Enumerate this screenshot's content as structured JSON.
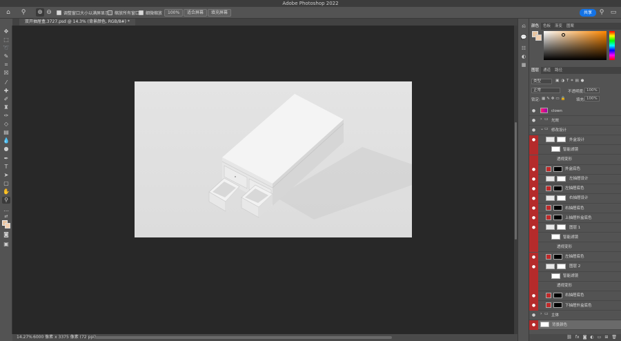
{
  "app": {
    "title": "Adobe Photoshop 2022"
  },
  "options_bar": {
    "resize_windows_label": "调整窗口大小以满屏显示",
    "zoom_all_label": "缩放所有窗口",
    "scrubby_zoom_label": "细微缩放",
    "zoom_100_label": "100%",
    "fit_screen_label": "适合屏幕",
    "fill_screen_label": "填充屏幕",
    "share_label": "共享"
  },
  "document_tab": {
    "label": "双开抽屉盒.3727.psd @ 14.3% (背景颜色, RGB/8#) *"
  },
  "status_bar": {
    "zoom": "14.27%",
    "doc_size": "6000 像素 x 3375 像素 (72 ppi)"
  },
  "color_panel": {
    "tabs": [
      "颜色",
      "色板",
      "渐变",
      "图案"
    ],
    "active_tab": "颜色",
    "foreground": "#e8c4a0",
    "background": "#f2d0b0"
  },
  "layers_panel": {
    "tabs": [
      "图层",
      "通道",
      "路径"
    ],
    "active_tab": "图层",
    "filter_kind": "类型",
    "blend_mode": "正常",
    "opacity_label": "不透明度:",
    "opacity_value": "100%",
    "lock_label": "锁定:",
    "fill_label": "填充:",
    "fill_value": "100%",
    "layers": [
      {
        "name": "clown",
        "indent": 0,
        "thumb": "magenta",
        "visible_red": false
      },
      {
        "name": "光效",
        "indent": 0,
        "thumb": "folder",
        "visible_red": false
      },
      {
        "name": "修改设计",
        "indent": 0,
        "thumb": "folder-open",
        "visible_red": false
      },
      {
        "name": "外盒设计",
        "indent": 1,
        "thumb": "smart",
        "visible_red": true
      },
      {
        "name": "智能滤镜",
        "indent": 2,
        "thumb": "white",
        "visible_red": true
      },
      {
        "name": "透视变形",
        "indent": 3,
        "thumb": "none",
        "visible_red": true
      },
      {
        "name": "外盒底色",
        "indent": 1,
        "thumb": "red-black",
        "visible_red": true
      },
      {
        "name": "左抽屉设计",
        "indent": 1,
        "thumb": "smart",
        "visible_red": true
      },
      {
        "name": "左抽屉底色",
        "indent": 1,
        "thumb": "red-black",
        "visible_red": true
      },
      {
        "name": "右抽屉设计",
        "indent": 1,
        "thumb": "smart",
        "visible_red": true
      },
      {
        "name": "右抽屉底色",
        "indent": 1,
        "thumb": "red-black",
        "visible_red": true
      },
      {
        "name": "上抽屉外盒底色",
        "indent": 1,
        "thumb": "red-black",
        "visible_red": true
      },
      {
        "name": "图层 1",
        "indent": 1,
        "thumb": "smart",
        "visible_red": true
      },
      {
        "name": "智能滤镜",
        "indent": 2,
        "thumb": "white",
        "visible_red": true
      },
      {
        "name": "透视变形",
        "indent": 3,
        "thumb": "none",
        "visible_red": true
      },
      {
        "name": "左抽屉底色",
        "indent": 1,
        "thumb": "red-black",
        "visible_red": true
      },
      {
        "name": "图层 2",
        "indent": 1,
        "thumb": "smart",
        "visible_red": true
      },
      {
        "name": "智能滤镜",
        "indent": 2,
        "thumb": "white",
        "visible_red": true
      },
      {
        "name": "透视变形",
        "indent": 3,
        "thumb": "none",
        "visible_red": true
      },
      {
        "name": "右抽屉底色",
        "indent": 1,
        "thumb": "red-black",
        "visible_red": true
      },
      {
        "name": "下抽屉外盒底色",
        "indent": 1,
        "thumb": "red-black",
        "visible_red": true
      },
      {
        "name": "主体",
        "indent": 0,
        "thumb": "folder",
        "visible_red": false
      },
      {
        "name": "背景颜色",
        "indent": 0,
        "thumb": "white",
        "visible_red": true
      }
    ]
  }
}
